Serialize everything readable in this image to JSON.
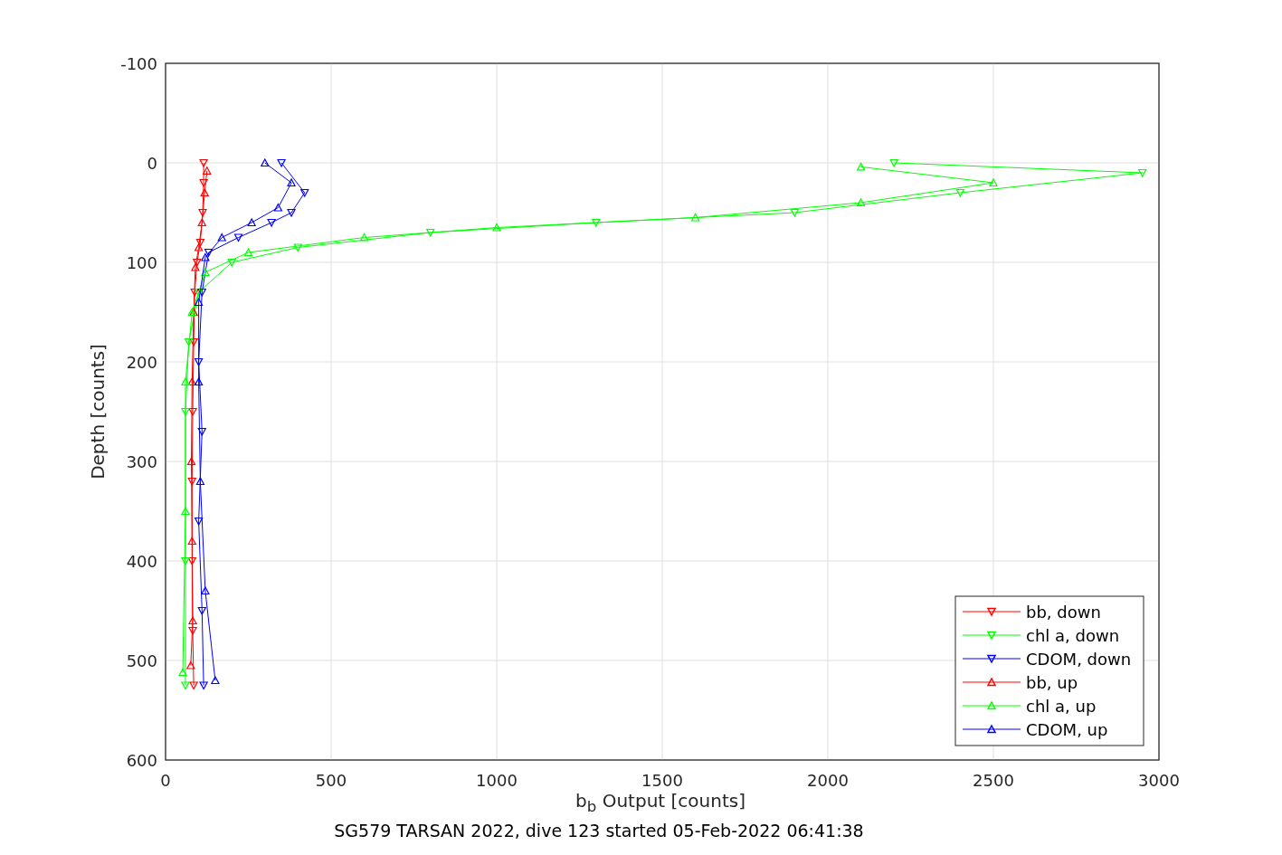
{
  "figure": {
    "chart_data": {
      "type": "line",
      "xlabel": "b$_{b}$ Output [counts]",
      "ylabel": "Depth [counts]",
      "title": "SG579 TARSAN 2022, dive 123 started 05-Feb-2022 06:41:38",
      "xlim": [
        0,
        3000
      ],
      "ylim": [
        600,
        -100
      ],
      "xticks": [
        0,
        500,
        1000,
        1500,
        2000,
        2500,
        3000
      ],
      "yticks": [
        -100,
        0,
        100,
        200,
        300,
        400,
        500,
        600
      ],
      "grid": true,
      "legend": true,
      "series": [
        {
          "name": "bb, down",
          "color": "#ff0000",
          "marker": "triangle-down",
          "x": [
            115,
            115,
            112,
            105,
            95,
            88,
            85,
            82,
            80,
            80,
            82,
            85
          ],
          "values": [
            0,
            20,
            50,
            80,
            100,
            130,
            180,
            250,
            320,
            400,
            470,
            525
          ]
        },
        {
          "name": "chl a, down",
          "color": "#00ff00",
          "marker": "triangle-down",
          "x": [
            2200,
            2950,
            2400,
            1900,
            1300,
            800,
            400,
            200,
            100,
            70,
            60,
            60,
            60
          ],
          "values": [
            0,
            10,
            30,
            50,
            60,
            70,
            85,
            100,
            130,
            180,
            250,
            400,
            525
          ]
        },
        {
          "name": "CDOM, down",
          "color": "#0000ff",
          "marker": "triangle-down",
          "x": [
            350,
            420,
            380,
            320,
            220,
            130,
            110,
            100,
            110,
            100,
            110,
            115
          ],
          "values": [
            0,
            30,
            50,
            60,
            75,
            90,
            130,
            200,
            270,
            360,
            450,
            525
          ]
        },
        {
          "name": "bb, up",
          "color": "#ff0000",
          "marker": "triangle-up",
          "x": [
            125,
            118,
            110,
            100,
            90,
            85,
            80,
            78,
            80,
            82,
            76
          ],
          "values": [
            8,
            30,
            60,
            85,
            105,
            150,
            220,
            300,
            380,
            460,
            505
          ]
        },
        {
          "name": "chl a, up",
          "color": "#00ff00",
          "marker": "triangle-up",
          "x": [
            2100,
            2500,
            2100,
            1600,
            1000,
            600,
            250,
            120,
            80,
            60,
            60,
            52
          ],
          "values": [
            4,
            20,
            40,
            55,
            65,
            75,
            90,
            110,
            150,
            220,
            350,
            512
          ]
        },
        {
          "name": "CDOM, up",
          "color": "#0000ff",
          "marker": "triangle-up",
          "x": [
            300,
            380,
            340,
            260,
            170,
            120,
            100,
            100,
            105,
            120,
            150
          ],
          "values": [
            0,
            20,
            45,
            60,
            75,
            95,
            140,
            220,
            320,
            430,
            520
          ]
        }
      ]
    }
  }
}
